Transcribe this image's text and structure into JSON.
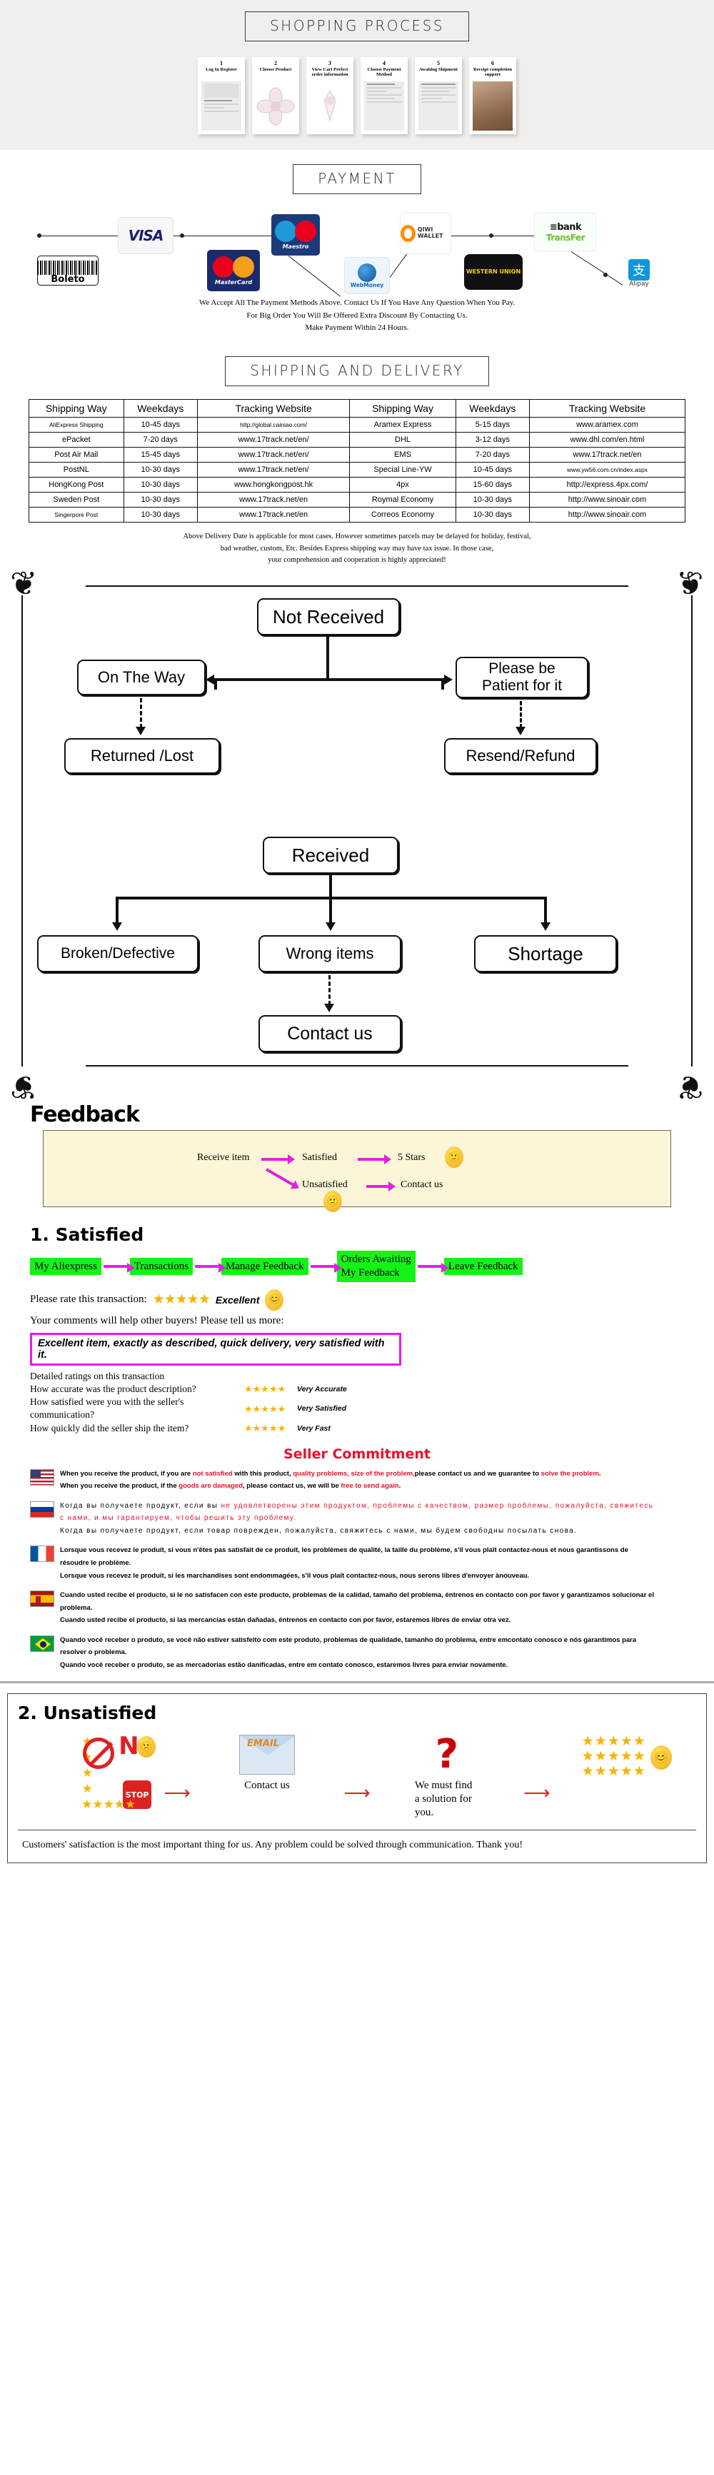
{
  "shopping": {
    "banner": "SHOPPING  PROCESS",
    "steps": [
      {
        "num": "1",
        "label": "Log In Register",
        "art": "skeleton-form"
      },
      {
        "num": "2",
        "label": "Choose Product",
        "art": "product-flower"
      },
      {
        "num": "3",
        "label": "View Cart Perfect order information",
        "art": "product-jewelry"
      },
      {
        "num": "4",
        "label": "Choose Payment Method",
        "art": "skeleton-form"
      },
      {
        "num": "5",
        "label": "Awaiting Shipment",
        "art": "skeleton-list"
      },
      {
        "num": "6",
        "label": "Receipt completion support",
        "art": "photo-parcel"
      }
    ]
  },
  "payment": {
    "banner": "PAYMENT",
    "logos": [
      {
        "name": "visa",
        "text": "VISA"
      },
      {
        "name": "boleto",
        "text": "Boleto"
      },
      {
        "name": "mastercard",
        "text": "MasterCard"
      },
      {
        "name": "maestro",
        "text": "Maestro"
      },
      {
        "name": "webmoney",
        "text": "WebMoney"
      },
      {
        "name": "qiwi-wallet",
        "text": "QIWI WALLET"
      },
      {
        "name": "western-union",
        "text": "WESTERN UNION"
      },
      {
        "name": "bank-transfer",
        "text": "bank TransFer"
      },
      {
        "name": "alipay",
        "text": "Alipay"
      }
    ],
    "note_line1": "We Accept All The Payment Methods Above. Contact Us If You Have Any Question When You Pay.",
    "note_line2": "For Big Order You Will Be Offered Extra Discount By Contacting Us.",
    "note_line3": "Make Payment Within 24 Hours."
  },
  "shipping": {
    "banner": "SHIPPING  AND  DELIVERY",
    "headers": [
      "Shipping Way",
      "Weekdays",
      "Tracking Website",
      "Shipping Way",
      "Weekdays",
      "Tracking Website"
    ],
    "rows": [
      [
        "AliExpress Shipping",
        "10-45 days",
        "http://global.cainiao.com/",
        "Aramex Express",
        "5-15 days",
        "www.aramex.com"
      ],
      [
        "ePacket",
        "7-20 days",
        "www.17track.net/en/",
        "DHL",
        "3-12 days",
        "www.dhl.com/en.html"
      ],
      [
        "Post Air Mail",
        "15-45 days",
        "www.17track.net/en/",
        "EMS",
        "7-20 days",
        "www.17track.net/en"
      ],
      [
        "PostNL",
        "10-30 days",
        "www.17track.net/en/",
        "Special Line-YW",
        "10-45 days",
        "www.yw56.com.cn/index.aspx"
      ],
      [
        "HongKong Post",
        "10-30 days",
        "www.hongkongpost.hk",
        "4px",
        "15-60 days",
        "http://express.4px.com/"
      ],
      [
        "Sweden Post",
        "10-30 days",
        "www.17track.net/en",
        "Roymal Economy",
        "10-30 days",
        "http://www.sinoair.com"
      ],
      [
        "Singerpore Post",
        "10-30 days",
        "www.17track.net/en",
        "Correos Economy",
        "10-30 days",
        "http://www.sinoair.com"
      ]
    ],
    "note_line1": "Above Delivery Date is applicable for most cases. However sometimes parcels may be delayed for holiday, festival,",
    "note_line2": "bad weather, custom, Etc. Besides Express shipping way may have tax issue. In those case,",
    "note_line3": "your comprehension and cooperation is highly appreciated!"
  },
  "flow": {
    "not_received": "Not Received",
    "on_the_way": "On The Way",
    "please_be_patient": "Please be\nPatient for it",
    "returned_lost": "Returned /Lost",
    "resend_refund": "Resend/Refund",
    "received": "Received",
    "broken_defective": "Broken/Defective",
    "wrong_items": "Wrong items",
    "shortage": "Shortage",
    "contact_us": "Contact us"
  },
  "feedback": {
    "title": "Feedback",
    "receive_item": "Receive item",
    "satisfied": "Satisfied",
    "five_stars": "5 Stars",
    "unsatisfied": "Unsatisfied",
    "contact_us": "Contact us",
    "smiley_happy": "🙂",
    "smiley_sad": "🙁"
  },
  "satisfied": {
    "heading": "1. Satisfied",
    "steps": [
      "My Aliexpress",
      "Transactions",
      "Manage Feedback",
      "Orders Awaiting\nMy Feedback",
      "Leave Feedback"
    ],
    "rate_label": "Please rate this transaction:",
    "rate_stars": "★★★★★",
    "rate_word": "Excellent",
    "comments_prompt": "Your comments will help other buyers! Please tell us more:",
    "comment_text": "Excellent item, exactly as described, quick delivery, very satisfied with it.",
    "detailed_heading": "Detailed ratings on this transaction",
    "detail_rows": [
      {
        "question": "How accurate was the product description?",
        "stars": "★★★★★",
        "value": "Very Accurate"
      },
      {
        "question": "How satisfied were you with the seller's communication?",
        "stars": "★★★★★",
        "value": "Very Satisfied"
      },
      {
        "question": "How quickly did the seller ship the item?",
        "stars": "★★★★★",
        "value": "Very Fast"
      }
    ]
  },
  "commitment": {
    "title": "Seller Commitment",
    "blocks": [
      {
        "flag": "flag-us",
        "lines": [
          [
            {
              "t": "When you receive the product, if you are ",
              "c": "k"
            },
            {
              "t": "not satisfied",
              "c": "r"
            },
            {
              "t": " with this product, ",
              "c": "k"
            },
            {
              "t": "quality problems, size of the problem,",
              "c": "r"
            },
            {
              "t": "please contact us and we guarantee to ",
              "c": "k"
            },
            {
              "t": "solve the problem",
              "c": "r"
            },
            {
              "t": ".",
              "c": "k"
            }
          ],
          [
            {
              "t": "When you receive the product, if the ",
              "c": "k"
            },
            {
              "t": "goods are damaged",
              "c": "r"
            },
            {
              "t": ", please contact us, we will be ",
              "c": "k"
            },
            {
              "t": "free to send again",
              "c": "r"
            },
            {
              "t": ".",
              "c": "k"
            }
          ]
        ]
      },
      {
        "flag": "flag-ru",
        "russian": true,
        "lines": [
          [
            {
              "t": "Когда вы получаете продукт, если вы ",
              "c": "k"
            },
            {
              "t": "не удовлетворены этим продуктом, проблемы с качеством, размер проблемы, пожалуйста, свяжитесь с нами, и мы гарантируем, чтобы решить эту проблему.",
              "c": "r"
            }
          ],
          [
            {
              "t": "Когда вы получаете продукт, если товар поврежден, пожалуйста, свяжитесь с нами, мы будем свободны посылать снова.",
              "c": "k"
            }
          ]
        ]
      },
      {
        "flag": "flag-fr",
        "lines": [
          [
            {
              "t": "Lorsque vous recevez le produit, si vous n'êtes pas satisfait de ce produit, les problèmes de qualité, la taille du problème, s'il vous plaît contactez-nous et nous garantissons de résoudre le problème.",
              "c": "k"
            }
          ],
          [
            {
              "t": "Lorsque vous recevez le produit, si les marchandises sont endommagées, s'il vous plaît contactez-nous, nous serons libres d'envoyer ànouveau.",
              "c": "k"
            }
          ]
        ]
      },
      {
        "flag": "flag-es",
        "lines": [
          [
            {
              "t": "Cuando usted recibe el producto, si le no satisfacen con este producto, problemas de la calidad, tamaño del problema, éntrenos en contacto con por favor y garantizamos solucionar el problema.",
              "c": "k"
            }
          ],
          [
            {
              "t": "Cuando usted recibe el producto, si las mercancías están dañadas, éntrenos en contacto con por favor, estaremos libres de enviar otra vez.",
              "c": "k"
            }
          ]
        ]
      },
      {
        "flag": "flag-br",
        "lines": [
          [
            {
              "t": "Quando você receber o produto, se você não estiver satisfeito com este produto, problemas de qualidade, tamanho do problema, entre emcontato conosco e nós garantimos para resolver o problema.",
              "c": "k"
            }
          ],
          [
            {
              "t": "Quando você receber o produto, se as mercadorias estão danificadas, entre em contato conosco, estaremos livres para enviar novamente.",
              "c": "k"
            }
          ]
        ]
      }
    ]
  },
  "unsatisfied": {
    "heading": "2. Unsatisfied",
    "no_letter": "N",
    "stop_text": "STOP",
    "email_word": "EMAIL",
    "contact_caption": "Contact us",
    "solution_caption": "We must find\na solution for\nyou.",
    "good_stars_rows": [
      "★★★★★",
      "★★★★★",
      "★★★★★"
    ],
    "bad_stars_rows": [
      "★★★★",
      "★★★★★"
    ],
    "footer": "Customers' satisfaction is the most important thing for us. Any problem could be solved through communication. Thank you!"
  },
  "colors": {
    "page_bg": "#ffffff",
    "shopping_bg": "#f0efed",
    "feedback_box_bg": "#fcf6d8",
    "green": "#15f215",
    "magenta": "#e221e2",
    "red": "#e8112d",
    "star": "#f5b400"
  }
}
